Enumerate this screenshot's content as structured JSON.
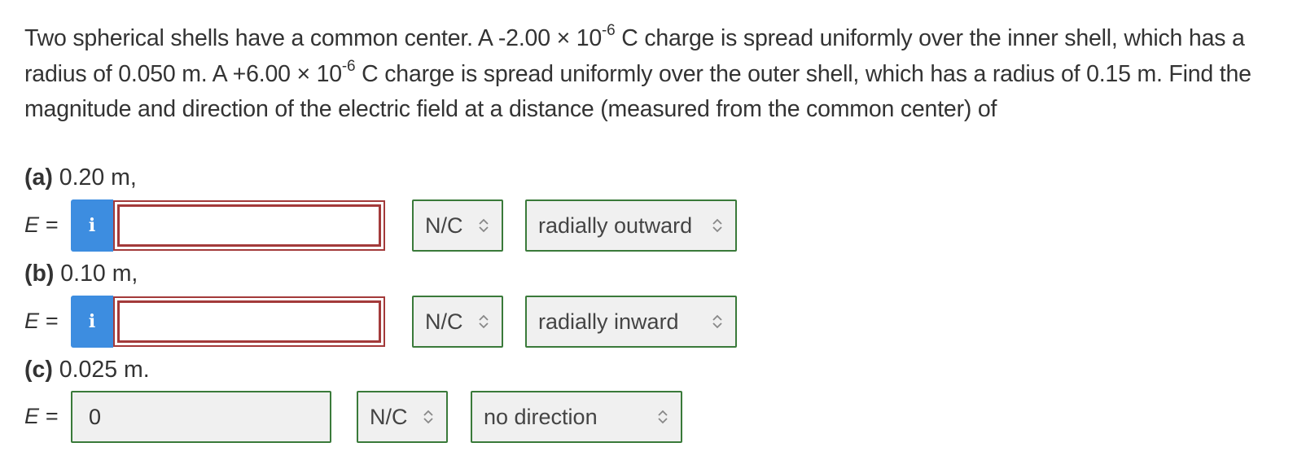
{
  "question": {
    "s1": "Two spherical shells have a common center. A -2.00 × 10",
    "exp1": "-6",
    "s2": " C charge is spread uniformly over the inner shell, which has a radius of 0.050 m. A +6.00 × 10",
    "exp2": "-6",
    "s3": " C charge is spread uniformly over the outer shell, which has a radius of 0.15 m. Find the magnitude and direction of the electric field at a distance (measured from the common center) of"
  },
  "parts": {
    "a": {
      "label": "(a)",
      "text": " 0.20 m,",
      "e_label": "E =",
      "value": "",
      "unit": "N/C",
      "direction": "radially outward"
    },
    "b": {
      "label": "(b)",
      "text": " 0.10 m,",
      "e_label": "E =",
      "value": "",
      "unit": "N/C",
      "direction": "radially inward"
    },
    "c": {
      "label": "(c)",
      "text": " 0.025 m.",
      "e_label": "E =",
      "value": "0",
      "unit": "N/C",
      "direction": "no direction"
    }
  },
  "info_glyph": "i",
  "colors": {
    "info": "#3d8de0",
    "error_border": "#a33a3a",
    "correct_border": "#3a7a3a"
  }
}
